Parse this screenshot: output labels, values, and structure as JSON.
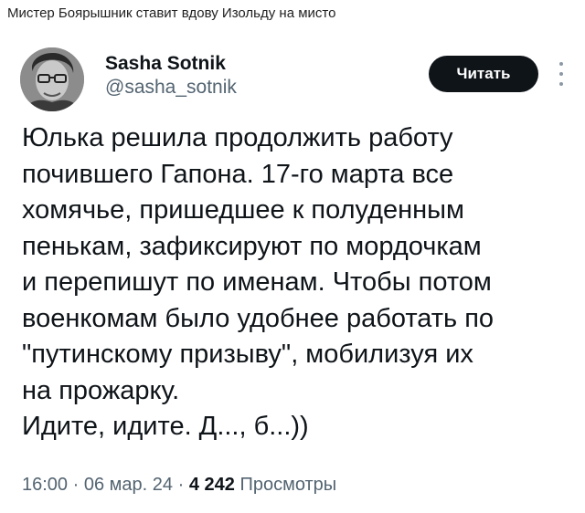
{
  "caption": "Мистер Боярышник ставит вдову Изольду на мисто",
  "tweet": {
    "author_name": "Sasha Sotnik",
    "author_handle": "@sasha_sotnik",
    "follow_label": "Читать",
    "more_icon": "more-vertical-icon",
    "lines": [
      "Юлька решила продолжить работу",
      "почившего Гапона. 17-го марта все",
      "хомячье, пришедшее к полуденным",
      "пенькам, зафиксируют по мордочкам",
      "и перепишут по именам. Чтобы потом",
      "военкомам было удобнее работать по",
      "\"путинскому призыву\", мобилизуя их",
      "на прожарку.",
      "Идите, идите. Д..., б...))"
    ],
    "time": "16:00",
    "date": "06 мар. 24",
    "views_count": "4 242",
    "views_label": "Просмотры",
    "separator": "·"
  },
  "colors": {
    "text": "#0f1419",
    "secondary": "#536471",
    "button_bg": "#0f1419",
    "button_text": "#ffffff"
  }
}
